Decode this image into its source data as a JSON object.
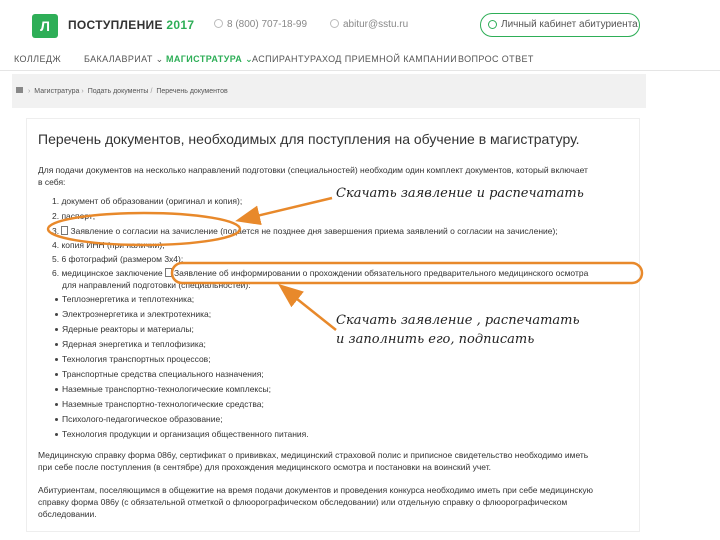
{
  "header": {
    "logo_text": "Л",
    "brand": "ПОСТУПЛЕНИЕ",
    "year": "2017",
    "phone": "8 (800) 707-18-99",
    "email": "abitur@sstu.ru",
    "cabinet_button": "Личный кабинет абитуриента"
  },
  "nav": {
    "items": [
      {
        "label": "КОЛЛЕДЖ"
      },
      {
        "label": "БАКАЛАВРИАТ ⌄"
      },
      {
        "label": "МАГИСТРАТУРА ⌄"
      },
      {
        "label": "АСПИРАНТУРА"
      },
      {
        "label": "ХОД ПРИЕМНОЙ КАМПАНИИ"
      },
      {
        "label": "ВОПРОС ОТВЕТ"
      }
    ]
  },
  "breadcrumb": {
    "items": [
      "Магистратура",
      "Подать документы",
      "Перечень документов"
    ]
  },
  "content": {
    "title": "Перечень документов, необходимых для поступления на обучение в магистратуру.",
    "intro_1": "Для подачи документов на несколько направлений подготовки (специальностей) необходим один комплект документов, который включает",
    "intro_2": "в себя:",
    "list": [
      "1. документ об образовании (оригинал и копия);",
      "2. паспорт;",
      "3.",
      "4. копия ИНН (при наличии);",
      "5. 6 фотографий (размером 3х4);",
      "6. медицинское заключение"
    ],
    "link_consent": "Заявление о согласии на зачисление (подается не позднее дня завершения приема заявлений о согласии на зачисление);",
    "link_medical": "Заявление об информировании о прохождении обязательного предварительного медицинского осмотра",
    "medical_cont": "для направлений подготовки (специальностей):",
    "bullets": [
      "Теплоэнергетика и теплотехника;",
      "Электроэнергетика и электротехника;",
      "Ядерные реакторы и материалы;",
      "Ядерная энергетика и теплофизика;",
      "Технология транспортных процессов;",
      "Транспортные средства специального назначения;",
      "Наземные транспортно-технологические комплексы;",
      "Наземные транспортно-технологические средства;",
      "Психолого-педагогическое образование;",
      "Технология продукции и организация общественного питания."
    ],
    "med_para_1": "Медицинскую справку форма 086у, сертификат о прививках, медицинский страховой полис и приписное свидетельство необходимо иметь",
    "med_para_2": "при себе после поступления (в сентябре) для прохождения медицинского осмотра и постановки на воинский учет.",
    "dorm_para_1": "Абитуриентам, поселяющимся в общежитие на время подачи документов и проведения конкурса необходимо иметь при себе медицинскую",
    "dorm_para_2": "справку форма 086у (с обязательной отметкой о флюорографическом обследовании) или отдельную справку о флюорографическом",
    "dorm_para_3": "обследовании."
  },
  "annotations": {
    "note1": "Скачать заявление и распечатать",
    "note2_line1": "Скачать заявление , распечатать",
    "note2_line2": "и заполнить его, подписать",
    "color": "#e8892b"
  },
  "colors": {
    "brand_green": "#2eae57",
    "annotation_orange": "#e8892b"
  }
}
